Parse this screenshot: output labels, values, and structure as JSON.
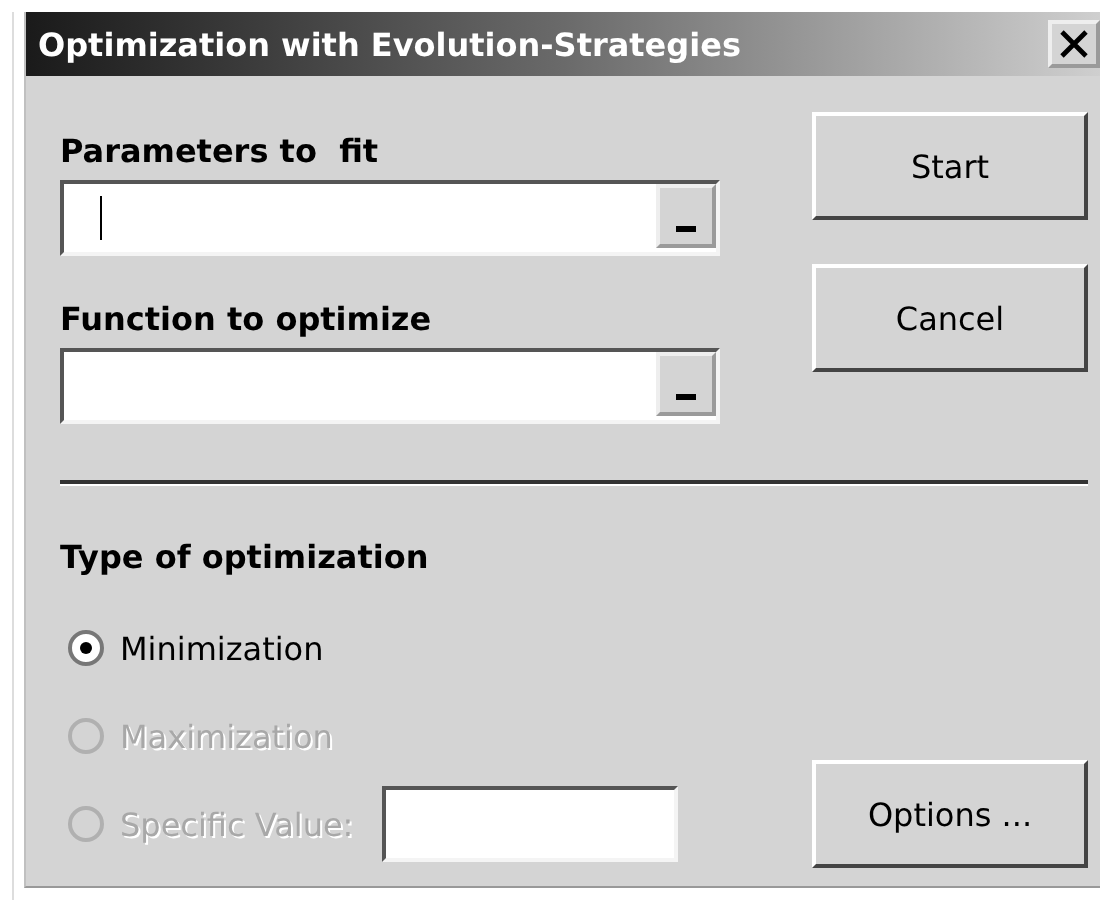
{
  "window": {
    "title": "Optimization with Evolution-Strategies"
  },
  "fields": [
    {
      "label": "Parameters to  fit",
      "focused": true
    },
    {
      "label": "Function to optimize",
      "focused": false
    }
  ],
  "buttons": [
    "Start",
    "Cancel"
  ],
  "group": {
    "title": "Type of optimization",
    "options": [
      {
        "label": "Minimization",
        "selected": true,
        "disabled": false,
        "kind": "plain"
      },
      {
        "label": "Maximization",
        "selected": false,
        "disabled": true,
        "kind": "plain"
      },
      {
        "label": "Specific Value:",
        "selected": false,
        "disabled": true,
        "kind": "value"
      }
    ]
  },
  "options_button": "Options ..."
}
